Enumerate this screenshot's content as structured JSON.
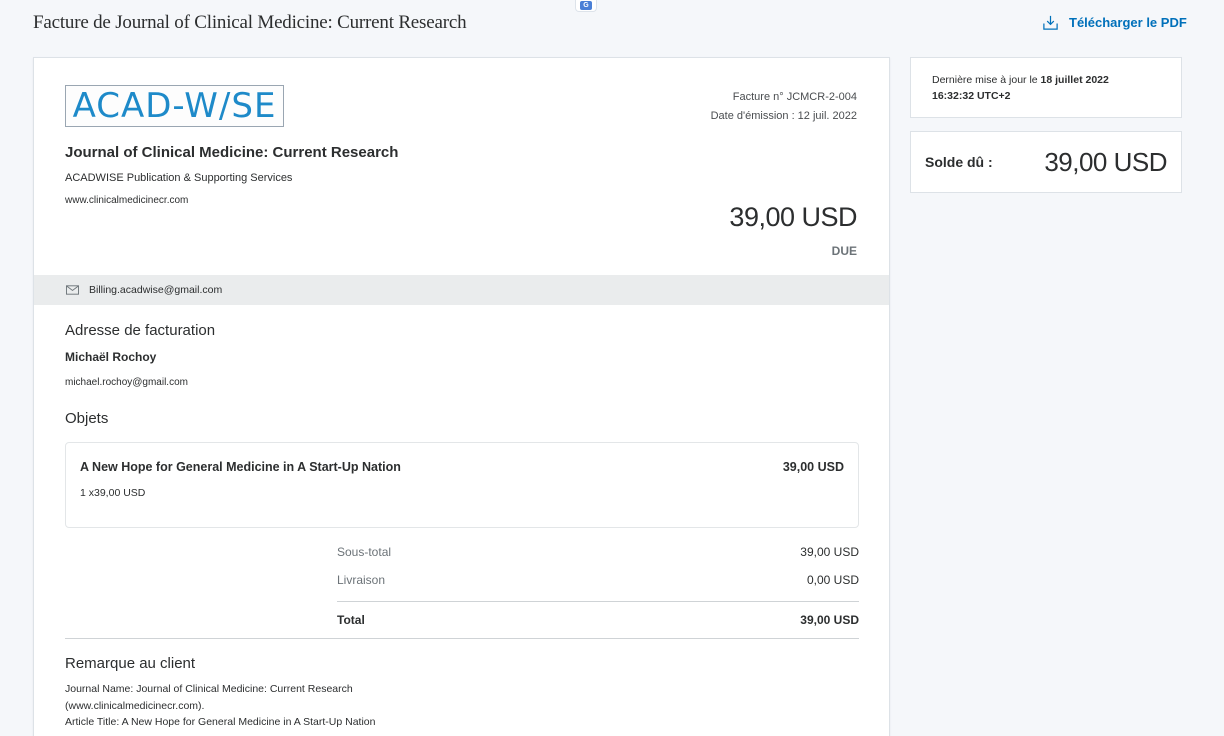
{
  "header": {
    "title": "Facture de Journal of Clinical Medicine: Current Research",
    "download_label": "Télécharger le PDF"
  },
  "invoice": {
    "logo_text": "ACAD-W/SE",
    "number": "Facture n° JCMCR-2-004",
    "issue_date": "Date d'émission : 12 juil. 2022",
    "org_name": "Journal of Clinical Medicine: Current Research",
    "org_subtitle": "ACADWISE Publication & Supporting Services",
    "org_website": "www.clinicalmedicinecr.com",
    "amount": "39,00 USD",
    "status": "DUE",
    "contact_email": "Billing.acadwise@gmail.com",
    "billing_title": "Adresse de facturation",
    "billing_name": "Michaël Rochoy",
    "billing_email": "michael.rochoy@gmail.com",
    "items_title": "Objets",
    "items": [
      {
        "title": "A New Hope for General Medicine in A Start-Up Nation",
        "qty": "1 x39,00 USD",
        "price": "39,00 USD"
      }
    ],
    "subtotal_label": "Sous-total",
    "subtotal_value": "39,00 USD",
    "shipping_label": "Livraison",
    "shipping_value": "0,00 USD",
    "total_label": "Total",
    "total_value": "39,00 USD",
    "note_title": "Remarque au client",
    "note_lines": [
      "Journal Name: Journal of Clinical Medicine: Current Research",
      "(www.clinicalmedicinecr.com).",
      "Article Title: A New Hope for General Medicine in A Start-Up Nation"
    ]
  },
  "sidebar": {
    "updated_prefix": "Dernière mise à jour le",
    "updated_date": "18 juillet 2022",
    "updated_time": "16:32:32 UTC+2",
    "balance_label": "Solde dû :",
    "balance_value": "39,00 USD"
  },
  "colors": {
    "accent": "#0070ba",
    "logo": "#1e8ac9",
    "background": "#f5f7fa"
  }
}
